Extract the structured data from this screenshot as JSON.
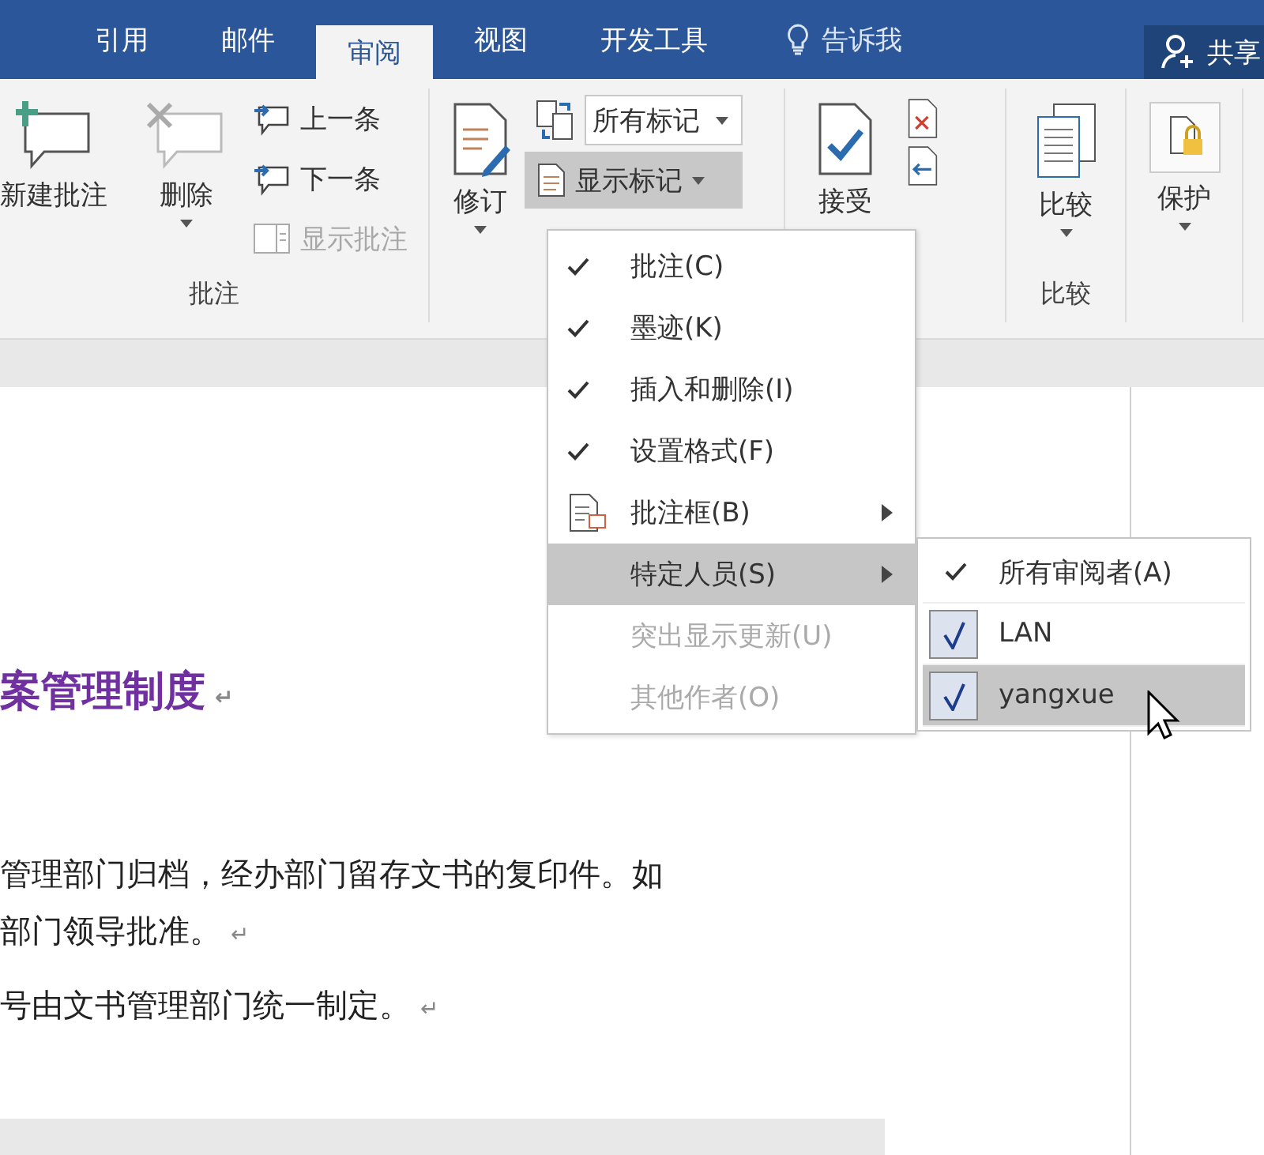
{
  "tabs": [
    {
      "label": "引用",
      "selected": false
    },
    {
      "label": "邮件",
      "selected": false
    },
    {
      "label": "审阅",
      "selected": true
    },
    {
      "label": "视图",
      "selected": false
    },
    {
      "label": "开发工具",
      "selected": false
    }
  ],
  "tell_me": "告诉我",
  "share": "共享",
  "comments": {
    "new": "新建批注",
    "delete": "删除",
    "previous": "上一条",
    "next": "下一条",
    "show": "显示批注",
    "show_disabled": true,
    "label": "批注"
  },
  "tracking": {
    "track": "修订",
    "markup_dropdown": "所有标记",
    "show_markup": "显示标记"
  },
  "changes": {
    "accept": "接受"
  },
  "compare": {
    "button": "比较",
    "label": "比较"
  },
  "protect": {
    "button": "保护"
  },
  "menu": [
    {
      "kind": "check",
      "label": "批注(C)",
      "checked": true,
      "disabled": false,
      "submenu": false,
      "selected": false
    },
    {
      "kind": "check",
      "label": "墨迹(K)",
      "checked": true,
      "disabled": false,
      "submenu": false,
      "selected": false
    },
    {
      "kind": "check",
      "label": "插入和删除(I)",
      "checked": true,
      "disabled": false,
      "submenu": false,
      "selected": false
    },
    {
      "kind": "check",
      "label": "设置格式(F)",
      "checked": true,
      "disabled": false,
      "submenu": false,
      "selected": false
    },
    {
      "kind": "icon",
      "label": "批注框(B)",
      "disabled": false,
      "submenu": true,
      "selected": false
    },
    {
      "kind": "plain",
      "label": "特定人员(S)",
      "disabled": false,
      "submenu": true,
      "selected": true
    },
    {
      "kind": "plain",
      "label": "突出显示更新(U)",
      "disabled": true,
      "submenu": false,
      "selected": false
    },
    {
      "kind": "plain",
      "label": "其他作者(O)",
      "disabled": true,
      "submenu": false,
      "selected": false
    }
  ],
  "submenu": [
    {
      "kind": "check",
      "label": "所有审阅者(A)",
      "checked": true,
      "selected": false
    },
    {
      "kind": "box",
      "label": "LAN",
      "checked": true,
      "selected": false
    },
    {
      "kind": "box",
      "label": "yangxue",
      "checked": true,
      "selected": true
    }
  ],
  "document": {
    "heading": "案管理制度",
    "heading_mark": "↵",
    "paragraphs": [
      {
        "lines": [
          "管理部门归档，经办部门留存文书的复印件。如",
          "部门领导批准。"
        ],
        "mark": "↵"
      },
      {
        "lines": [
          "号由文书管理部门统一制定。"
        ],
        "mark": "↵"
      }
    ]
  }
}
